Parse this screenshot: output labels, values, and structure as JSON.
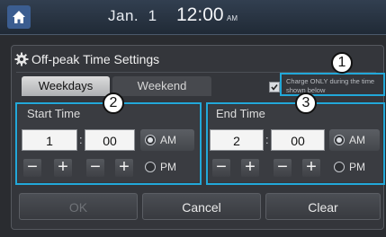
{
  "topbar": {
    "date": "Jan.  1",
    "time": "12:00",
    "ampm": "AM"
  },
  "dialog": {
    "title": "Off-peak Time Settings",
    "tabs": [
      {
        "label": "Weekdays",
        "selected": true
      },
      {
        "label": "Weekend",
        "selected": false
      }
    ],
    "charge_option": {
      "label": "Charge ONLY during the time shown below",
      "checked": true
    },
    "start": {
      "title": "Start Time",
      "hour": "1",
      "minute": "00",
      "am_label": "AM",
      "pm_label": "PM",
      "selected": "AM"
    },
    "end": {
      "title": "End Time",
      "hour": "2",
      "minute": "00",
      "am_label": "AM",
      "pm_label": "PM",
      "selected": "AM"
    },
    "stepper": {
      "minus": "−",
      "plus": "+"
    },
    "buttons": {
      "ok": "OK",
      "cancel": "Cancel",
      "clear": "Clear"
    }
  },
  "callouts": [
    "1",
    "2",
    "3"
  ],
  "colors": {
    "highlight": "#22a8d9"
  }
}
